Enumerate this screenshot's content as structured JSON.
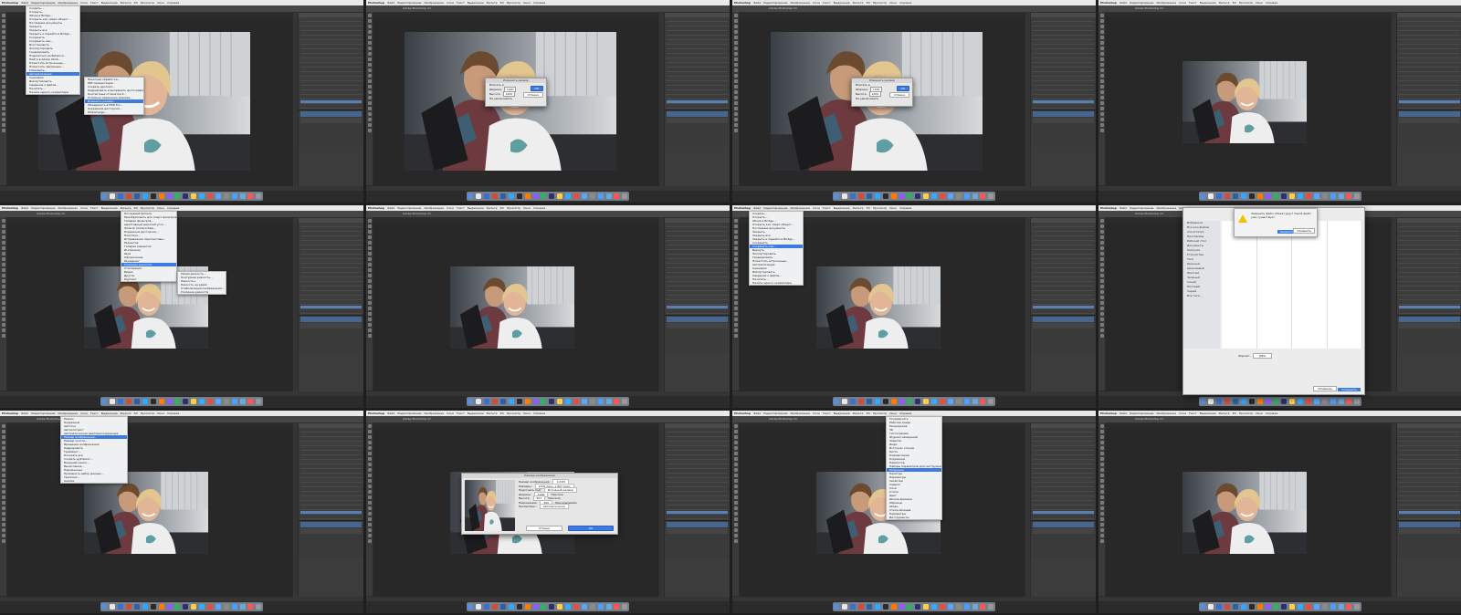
{
  "app": {
    "name": "Photoshop",
    "window_title": "Adobe Photoshop CC",
    "menus": [
      "Файл",
      "Редактирование",
      "Изображение",
      "Слои",
      "Текст",
      "Выделение",
      "Фильтр",
      "3D",
      "Просмотр",
      "Окно",
      "Справка"
    ]
  },
  "colors": {
    "menu_highlight": "#3b7be3",
    "ui_dark": "#2b2b2b",
    "panel": "#3c3c3c",
    "layer_selected": "#46658f"
  },
  "tiles": [
    {
      "id": 1,
      "state": "file-menu-open",
      "menu": {
        "items": [
          "Создать...",
          "Открыть...",
          "Обзор в Bridge...",
          "Открыть как смарт-объект...",
          "Последние документы",
          "Закрыть",
          "Закрыть все",
          "Закрыть и перейти в Bridge...",
          "Сохранить",
          "Сохранить как...",
          "Восстановить",
          "Экспортировать",
          "Генерировать",
          "Поделиться на Behance...",
          "Найти в Adobe Stock...",
          "Поместить встроенные...",
          "Поместить связанные...",
          "Упаковать...",
          "Автоматизация",
          "Сценарии",
          "Импортировать",
          "Сведения о файле...",
          "Печатать...",
          "Печать одного экземпляра"
        ],
        "highlighted": "Автоматизация"
      },
      "submenu": {
        "items": [
          "Пакетная обработка...",
          "PDF-презентация...",
          "Создать дроплет...",
          "Кадрировать и выпрямить фотографии",
          "Контактные отпечатки II...",
          "Условное изменение режима...",
          "Изменить размер...",
          "Объединить в HDR Pro...",
          "Коррекция дисторсии...",
          "Photomerge..."
        ],
        "highlighted": "Изменить размер..."
      }
    },
    {
      "id": 2,
      "state": "fit-image-dialog",
      "dialog": {
        "title": "Изменить размер",
        "constrain_label": "Вписать в",
        "width_label": "Ширина:",
        "width_value": "1200",
        "height_label": "Высота:",
        "height_value": "1200",
        "unit": "пикс.",
        "no_enlarge_label": "Не увеличивать",
        "ok": "ОК",
        "cancel": "Отмена"
      }
    },
    {
      "id": 3,
      "state": "fit-image-dialog-edited",
      "dialog": {
        "title": "Изменить размер",
        "constrain_label": "Вписать в",
        "width_label": "Ширина:",
        "width_value": "1200",
        "height_label": "Высота:",
        "height_value": "1200",
        "unit": "пикс.",
        "no_enlarge_label": "Не увеличивать",
        "ok": "ОК",
        "cancel": "Отмена"
      }
    },
    {
      "id": 4,
      "state": "image-resized"
    },
    {
      "id": 5,
      "state": "filter-menu-open",
      "menu": {
        "items": [
          "Последний фильтр",
          "Преобразовать для смарт-фильтров",
          "Галерея фильтров...",
          "Адаптивный широкий угол...",
          "Фильтр Camera Raw...",
          "Коррекция дисторсии...",
          "Пластика...",
          "Исправление перспективы...",
          "Размытие",
          "Галерея размытия",
          "Искажение",
          "Шум",
          "Оформление",
          "Рендеринг",
          "Усиление резкости",
          "Стилизация",
          "Видео",
          "Другое",
          "Digimarc"
        ],
        "highlighted": "Усиление резкости"
      },
      "submenu": {
        "items": [
          "Умная резкость...",
          "Контурная резкость...",
          "Резкость+",
          "Резкость на краях",
          "Стабилизация изображения...",
          "Усиление резкости"
        ],
        "highlighted": ""
      }
    },
    {
      "id": 6,
      "state": "sharpened"
    },
    {
      "id": 7,
      "state": "file-menu-save-as",
      "menu": {
        "items": [
          "Создать...",
          "Открыть...",
          "Обзор в Bridge...",
          "Открыть как смарт-объект...",
          "Последние документы",
          "Закрыть",
          "Закрыть все",
          "Закрыть и перейти в Bridge...",
          "Сохранить",
          "Сохранить как...",
          "Вернуть",
          "Экспортировать",
          "Генерировать",
          "Поместить встроенные...",
          "Автоматизация",
          "Сценарии",
          "Импортировать",
          "Сведения о файле...",
          "Печатать...",
          "Печать одного экземпляра"
        ],
        "highlighted": "Сохранить как..."
      }
    },
    {
      "id": 8,
      "state": "save-as-dialog",
      "alert": {
        "text": "Заменить файл «Макет.jpg»? Такой файл уже существует.",
        "replace": "Заменить",
        "cancel": "Отменить"
      },
      "sidebar": [
        "Избранное",
        "Все мои файлы",
        "iCloud Drive",
        "Программы",
        "Рабочий стол",
        "Документы",
        "Загрузки",
        "Устройства",
        "Теги",
        "Красный",
        "Оранжевый",
        "Желтый",
        "Зеленый",
        "Синий",
        "Лиловый",
        "Серый",
        "Все теги..."
      ],
      "format_label": "Формат:",
      "format_value": "JPEG",
      "save_label": "Сохранить",
      "cancel_label": "Отменить"
    },
    {
      "id": 9,
      "state": "image-menu-open",
      "menu": {
        "items": [
          "Режим",
          "Коррекция",
          "Автотон",
          "Автоконтраст",
          "Автоматическая цветовая коррекция",
          "Размер изображения...",
          "Размер холста...",
          "Вращение изображения",
          "Кадрировать",
          "Тримминг...",
          "Показать все",
          "Создать дубликат...",
          "Внешний канал...",
          "Вычисления...",
          "Переменные",
          "Применить набор данных...",
          "Треппинг...",
          "Анализ"
        ],
        "highlighted": "Размер изображения..."
      }
    },
    {
      "id": 10,
      "state": "image-size-dialog",
      "dialog": {
        "title": "Размер изображения",
        "size_label": "Размер изображения:",
        "size_value": "1,01M",
        "dimensions_label": "Размеры:",
        "dimensions_value": "1200 пикс. x 827 пикс.",
        "fit_label": "Подогнать под:",
        "fit_value": "Исходный размер",
        "width_label": "Ширина:",
        "width_value": "1200",
        "height_label": "Высота:",
        "height_value": "827",
        "resolution_label": "Разрешение:",
        "resolution_value": "300",
        "unit_px": "Пиксели",
        "unit_res": "Пикселы/дюйм",
        "resample_label": "Ресамплинг:",
        "resample_value": "Автоматически",
        "ok": "ОК",
        "cancel": "Отмена"
      }
    },
    {
      "id": 11,
      "state": "window-menu-open",
      "menu": {
        "items": [
          "Упорядочить",
          "Рабочая среда",
          "Расширения",
          "3D",
          "Гистограмма",
          "Журнал измерений",
          "Заметки",
          "Инфо",
          "Источник клонов",
          "Кисть",
          "Комментарии",
          "Коррекция",
          "Навигатор",
          "Наборы параметров для инструментов",
          "Операции",
          "Палитры",
          "Параметры",
          "Свойства",
          "Символ",
          "Слои",
          "Стили",
          "Цвет",
          "Шкала времени",
          "Образцы",
          "Абзац",
          "Стили абзацев",
          "Параметры",
          "Инструменты"
        ],
        "highlighted": "Операции"
      }
    },
    {
      "id": 12,
      "state": "actions-panel"
    }
  ]
}
